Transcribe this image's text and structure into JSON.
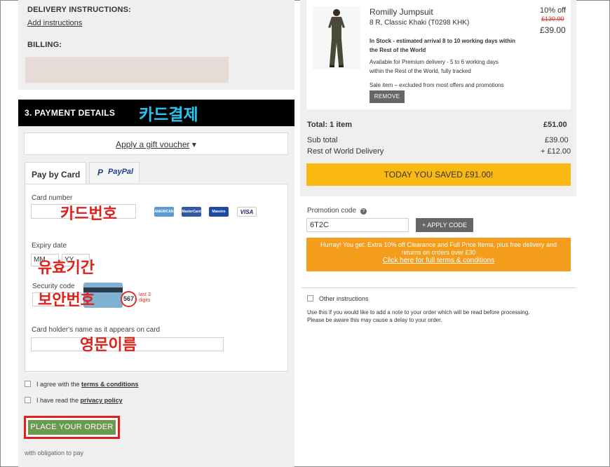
{
  "left": {
    "delivery_label": "DELIVERY INSTRUCTIONS:",
    "add_instructions": "Add instructions",
    "billing_label": "BILLING:",
    "payment_header": "3. PAYMENT DETAILS",
    "gift_voucher": "Apply a gift voucher",
    "tab_card": "Pay by Card",
    "tab_paypal": "PayPal",
    "card_number_label": "Card number",
    "card_logos": [
      {
        "name": "american-express",
        "text": "AMERICAN EXPRESS",
        "color": "#5b9bd5"
      },
      {
        "name": "mastercard",
        "text": "MasterCard",
        "color": "#2f5aa3"
      },
      {
        "name": "maestro",
        "text": "Maestro",
        "color": "#1b4aa0"
      },
      {
        "name": "visa",
        "text": "VISA",
        "color": "#ffffff"
      }
    ],
    "expiry_label": "Expiry date",
    "expiry_month": "MM",
    "expiry_year": "YY",
    "security_label": "Security code",
    "security_sample": "567",
    "security_note_1": "last 3",
    "security_note_2": "digits",
    "holder_label": "Card holder's name as it appears on card",
    "terms_text": "I agree with the ",
    "terms_link": "terms & conditions",
    "privacy_text": "I have read the ",
    "privacy_link": "privacy policy",
    "place_order": "PLACE YOUR ORDER",
    "obligation": "with obligation to pay"
  },
  "annotations": {
    "card_payment": "카드결제",
    "card_number": "카드번호",
    "expiry": "유효기간",
    "security": "보안번호",
    "english_name": "영문이름"
  },
  "right": {
    "product_name": "Romilly Jumpsuit",
    "product_variant": "8 R, Classic Khaki (T0298 KHK)",
    "discount": "10% off",
    "old_price": "£130.00",
    "new_price": "£39.00",
    "stock_1": "In Stock - estimated arrival 8 to 10 working days within",
    "stock_2": "the Rest of the World",
    "premium_1": "Available for Premium delivery - 5 to 6 working days",
    "premium_2": "within the Rest of the World, fully tracked",
    "sale_note": "Sale item – excluded from most offers and promotions",
    "remove": "REMOVE",
    "total_label": "Total: 1 item",
    "total_value": "£51.00",
    "subtotal_label": "Sub total",
    "subtotal_value": "£39.00",
    "delivery_label": "Rest of World Delivery",
    "delivery_value": "+ £12.00",
    "savings": "TODAY YOU SAVED £91.00!",
    "promo_label": "Promotion code",
    "promo_value": "6T2C",
    "apply_code": "+ APPLY CODE",
    "promo_note_1": "Hurray! You get: Extra 10% off Clearance and Full Price Items, plus free delivery and",
    "promo_note_2": "returns on orders over £30",
    "promo_link": "Click here for full terms & conditions",
    "other_instructions": "Other instructions",
    "other_note_1": "Use this if you would like to add a note to your order which will be read before processing.",
    "other_note_2": "Please be aware this may cause a delay to your order."
  }
}
